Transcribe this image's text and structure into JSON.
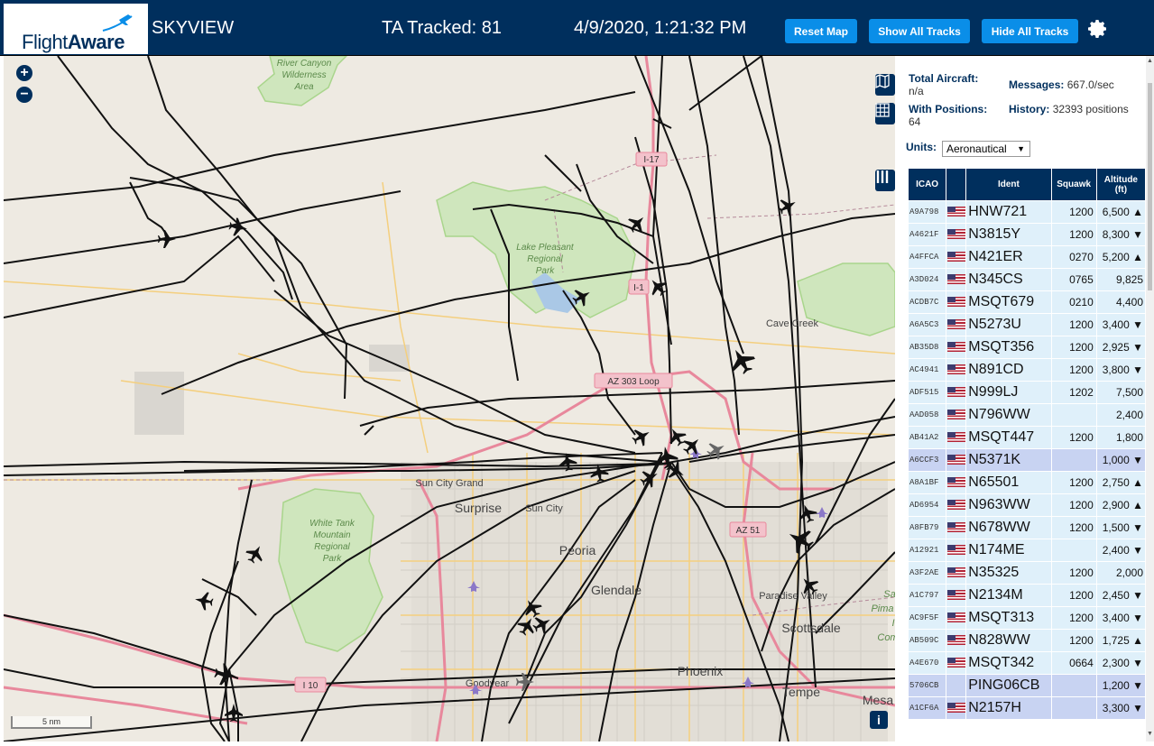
{
  "header": {
    "logo_text_light": "Flight",
    "logo_text_bold": "Aware",
    "app_title": "SKYVIEW",
    "ta_tracked": "TA Tracked: 81",
    "datetime": "4/9/2020, 1:21:32 PM",
    "buttons": {
      "reset": "Reset Map",
      "show_all": "Show All Tracks",
      "hide_all": "Hide All Tracks"
    }
  },
  "map": {
    "zoom_in": "+",
    "zoom_out": "−",
    "scale_label": "5 nm",
    "info_label": "i",
    "place_labels": {
      "river_canyon": [
        "River Canyon",
        "Wilderness",
        "Area"
      ],
      "lake_pleasant": [
        "Lake Pleasant",
        "Regional",
        "Park"
      ],
      "white_tank": [
        "White Tank",
        "Mountain",
        "Regional",
        "Park"
      ],
      "cave_creek": "Cave Creek",
      "sun_city_grand": "Sun City Grand",
      "surprise": "Surprise",
      "sun_city": "Sun City",
      "peoria": "Peoria",
      "glendale": "Glendale",
      "paradise_valley": "Paradise Valley",
      "scottsdale": "Scottsdale",
      "phoenix": "Phoenix",
      "tempe": "Tempe",
      "goodyear": "Goodyear",
      "mesa": "Mesa",
      "salt_river_1": "Sa",
      "salt_river_2": "Pima",
      "salt_river_3": "I",
      "salt_river_4": "Com"
    },
    "road_shields": {
      "i17_top": "I-17",
      "i17_mid": "I-1",
      "az303": "AZ 303 Loop",
      "az51": "AZ 51",
      "i10": "I 10"
    }
  },
  "sidebar": {
    "total_aircraft_label": "Total Aircraft:",
    "total_aircraft_value": "n/a",
    "with_positions_label": "With Positions:",
    "with_positions_value": "64",
    "messages_label": "Messages:",
    "messages_value": "667.0/sec",
    "history_label": "History:",
    "history_value": "32393 positions",
    "units_label": "Units:",
    "units_value": "Aeronautical",
    "columns": [
      "ICAO",
      "",
      "Ident",
      "Squawk",
      "Altitude (ft)"
    ],
    "rows": [
      {
        "icao": "A9A798",
        "flag": true,
        "ident": "HNW721",
        "squawk": "1200",
        "alt": "6,500 ▲",
        "selected": false
      },
      {
        "icao": "A4621F",
        "flag": true,
        "ident": "N3815Y",
        "squawk": "1200",
        "alt": "8,300 ▼",
        "selected": false
      },
      {
        "icao": "A4FFCA",
        "flag": true,
        "ident": "N421ER",
        "squawk": "0270",
        "alt": "5,200 ▲",
        "selected": false
      },
      {
        "icao": "A3D024",
        "flag": true,
        "ident": "N345CS",
        "squawk": "0765",
        "alt": "9,825",
        "selected": false
      },
      {
        "icao": "ACDB7C",
        "flag": true,
        "ident": "MSQT679",
        "squawk": "0210",
        "alt": "4,400",
        "selected": false
      },
      {
        "icao": "A6A5C3",
        "flag": true,
        "ident": "N5273U",
        "squawk": "1200",
        "alt": "3,400 ▼",
        "selected": false
      },
      {
        "icao": "AB35D8",
        "flag": true,
        "ident": "MSQT356",
        "squawk": "1200",
        "alt": "2,925 ▼",
        "selected": false
      },
      {
        "icao": "AC4941",
        "flag": true,
        "ident": "N891CD",
        "squawk": "1200",
        "alt": "3,800 ▼",
        "selected": false
      },
      {
        "icao": "ADF515",
        "flag": true,
        "ident": "N999LJ",
        "squawk": "1202",
        "alt": "7,500",
        "selected": false
      },
      {
        "icao": "AAD058",
        "flag": true,
        "ident": "N796WW",
        "squawk": "",
        "alt": "2,400",
        "selected": false
      },
      {
        "icao": "AB41A2",
        "flag": true,
        "ident": "MSQT447",
        "squawk": "1200",
        "alt": "1,800",
        "selected": false
      },
      {
        "icao": "A6CCF3",
        "flag": true,
        "ident": "N5371K",
        "squawk": "",
        "alt": "1,000 ▼",
        "selected": true
      },
      {
        "icao": "A8A1BF",
        "flag": true,
        "ident": "N65501",
        "squawk": "1200",
        "alt": "2,750 ▲",
        "selected": false
      },
      {
        "icao": "AD6954",
        "flag": true,
        "ident": "N963WW",
        "squawk": "1200",
        "alt": "2,900 ▲",
        "selected": false
      },
      {
        "icao": "A8FB79",
        "flag": true,
        "ident": "N678WW",
        "squawk": "1200",
        "alt": "1,500 ▼",
        "selected": false
      },
      {
        "icao": "A12921",
        "flag": true,
        "ident": "N174ME",
        "squawk": "",
        "alt": "2,400 ▼",
        "selected": false
      },
      {
        "icao": "A3F2AE",
        "flag": true,
        "ident": "N35325",
        "squawk": "1200",
        "alt": "2,000",
        "selected": false
      },
      {
        "icao": "A1C797",
        "flag": true,
        "ident": "N2134M",
        "squawk": "1200",
        "alt": "2,450 ▼",
        "selected": false
      },
      {
        "icao": "AC9F5F",
        "flag": true,
        "ident": "MSQT313",
        "squawk": "1200",
        "alt": "3,400 ▼",
        "selected": false
      },
      {
        "icao": "AB509C",
        "flag": true,
        "ident": "N828WW",
        "squawk": "1200",
        "alt": "1,725 ▲",
        "selected": false
      },
      {
        "icao": "A4E670",
        "flag": true,
        "ident": "MSQT342",
        "squawk": "0664",
        "alt": "2,300 ▼",
        "selected": false
      },
      {
        "icao": "5706CB",
        "flag": false,
        "ident": "PING06CB",
        "squawk": "",
        "alt": "1,200 ▼",
        "selected": true
      },
      {
        "icao": "A1CF6A",
        "flag": true,
        "ident": "N2157H",
        "squawk": "",
        "alt": "3,300 ▼",
        "selected": true
      }
    ]
  },
  "colors": {
    "header_bg": "#002f5d",
    "button_bg": "#0a8ee8",
    "row_bg": "#dff0fa",
    "row_selected_bg": "#c8d3f2",
    "map_bg": "#eeeae2",
    "park_green": "#a9d58c",
    "highway_pink": "#e8889c",
    "road_yellow": "#f4cf7e",
    "track_black": "#111111"
  },
  "icons": [
    "airplane-logo-icon",
    "gear-icon",
    "zoom-in-icon",
    "zoom-out-icon",
    "map-layers-icon",
    "grid-icon",
    "columns-icon",
    "info-icon",
    "aircraft-icon",
    "airport-icon"
  ]
}
